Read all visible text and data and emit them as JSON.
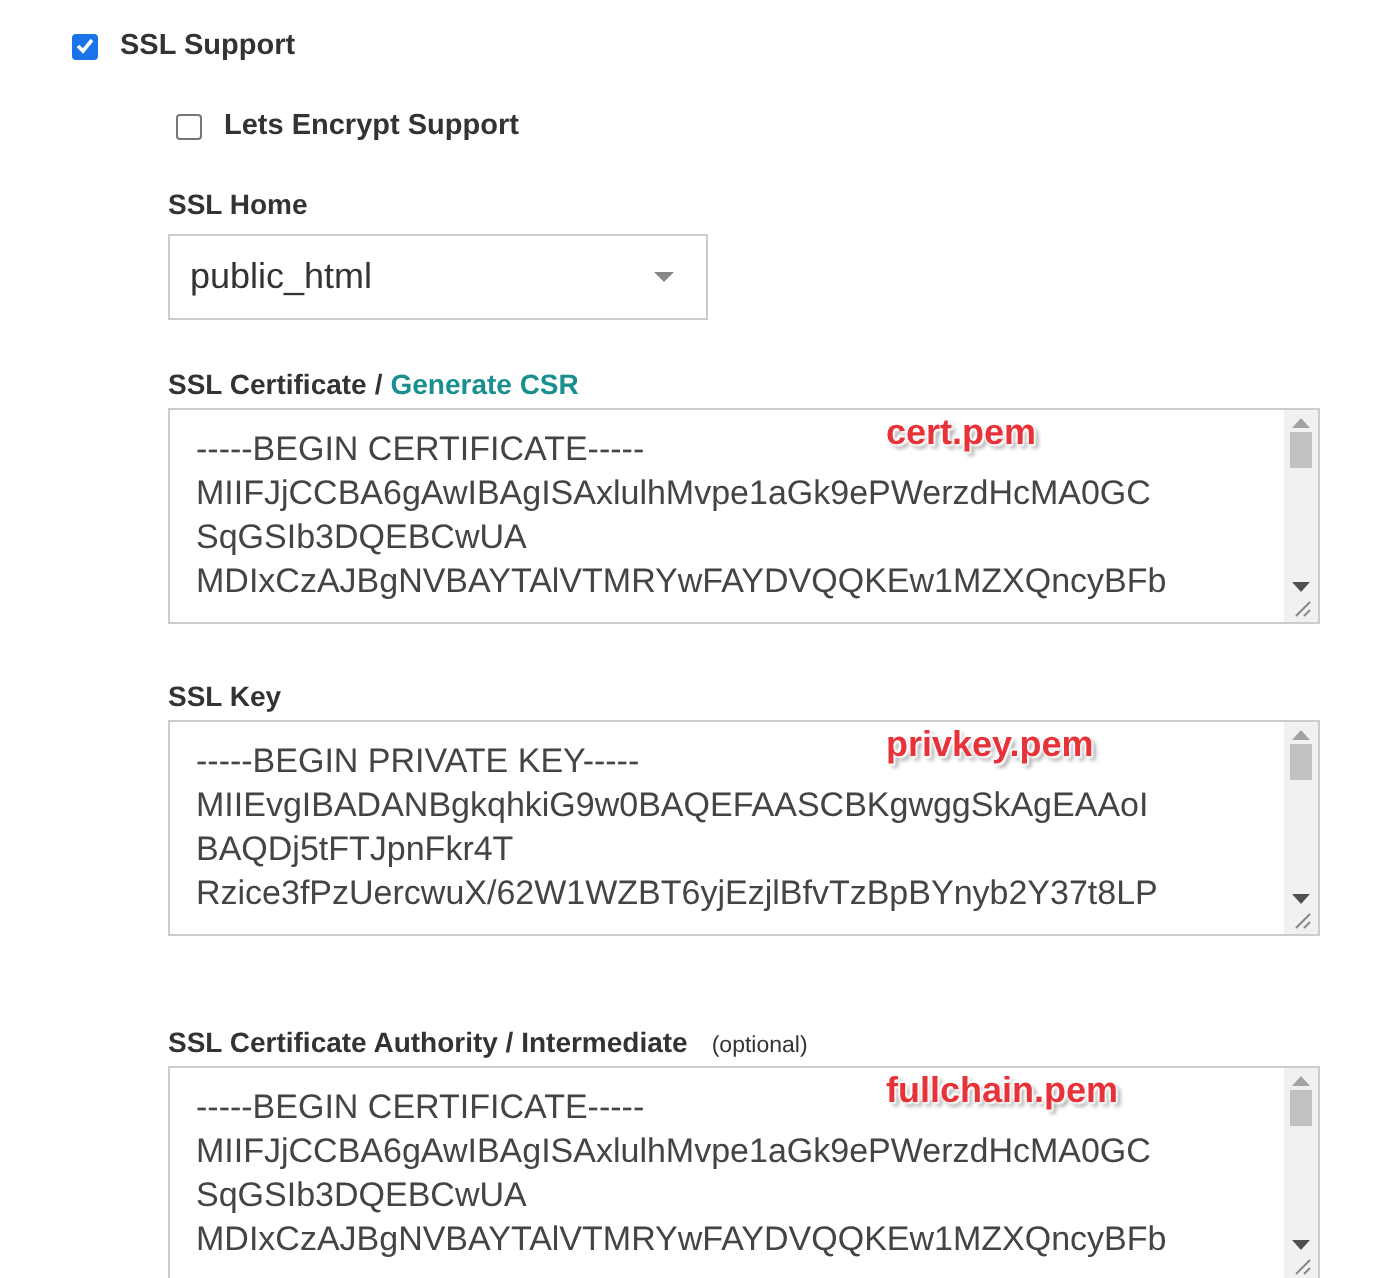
{
  "ssl_support": {
    "label": "SSL Support",
    "checked": true
  },
  "lets_encrypt": {
    "label": "Lets Encrypt Support",
    "checked": false
  },
  "ssl_home": {
    "label": "SSL Home",
    "value": "public_html"
  },
  "fields": [
    {
      "label": "SSL Certificate",
      "separator": "/",
      "link": "Generate CSR",
      "lines": [
        "-----BEGIN CERTIFICATE-----",
        "MIIFJjCCBA6gAwIBAgISAxlulhMvpe1aGk9ePWerzdHcMA0GC",
        "SqGSIb3DQEBCwUA",
        "MDIxCzAJBgNVBAYTAlVTMRYwFAYDVQQKEw1MZXQncyBFb"
      ],
      "annotation": "cert.pem"
    },
    {
      "label": "SSL Key",
      "lines": [
        "-----BEGIN PRIVATE KEY-----",
        "MIIEvgIBADANBgkqhkiG9w0BAQEFAASCBKgwggSkAgEAAoI",
        "BAQDj5tFTJpnFkr4T",
        "Rzice3fPzUercwuX/62W1WZBT6yjEzjlBfvTzBpBYnyb2Y37t8LP"
      ],
      "annotation": "privkey.pem"
    },
    {
      "label": "SSL Certificate Authority / Intermediate",
      "note": "(optional)",
      "lines": [
        "-----BEGIN CERTIFICATE-----",
        "MIIFJjCCBA6gAwIBAgISAxlulhMvpe1aGk9ePWerzdHcMA0GC",
        "SqGSIb3DQEBCwUA",
        "MDIxCzAJBgNVBAYTAlVTMRYwFAYDVQQKEw1MZXQncyBFb"
      ],
      "annotation": "fullchain.pem"
    }
  ]
}
